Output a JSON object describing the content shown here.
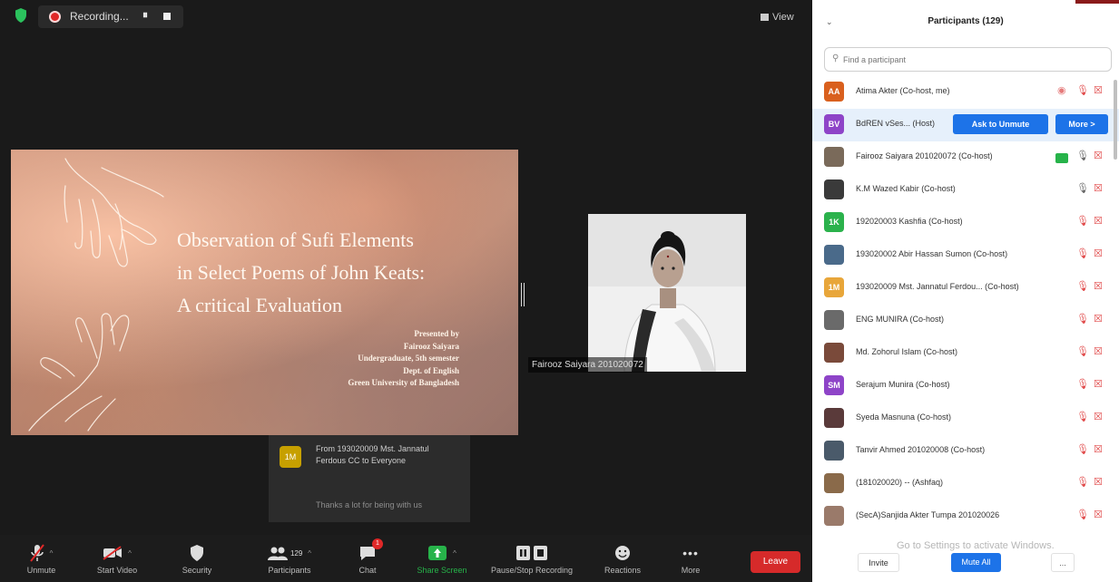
{
  "recording": {
    "label": "Recording...",
    "pause_glyph": "⏸",
    "state": "recording"
  },
  "view": {
    "label": "View"
  },
  "slide": {
    "title_lines": [
      "Observation of Sufi Elements",
      "in Select Poems of John Keats:",
      "A critical Evaluation"
    ],
    "presenter_lines": [
      "Presented by",
      "Fairooz Saiyara",
      "Undergraduate, 5th semester",
      "Dept. of English",
      "Green University of Bangladesh"
    ]
  },
  "video": {
    "name": "Fairooz Saiyara 201020072"
  },
  "chat": {
    "avatar_initials": "1M",
    "from_line": "From 193020009 Mst. Jannatul Ferdous CC to Everyone",
    "message": "Thanks a lot for being with us"
  },
  "toolbar": {
    "unmute": "Unmute",
    "start_video": "Start Video",
    "security": "Security",
    "participants": "Participants",
    "participants_count": "129",
    "chat": "Chat",
    "chat_badge": "1",
    "share_screen": "Share Screen",
    "pause_stop_recording": "Pause/Stop Recording",
    "reactions": "Reactions",
    "more": "More",
    "leave": "Leave",
    "colors": {
      "share": "#27b34a",
      "leave": "#d62a2a",
      "chat_badge": "#e02828"
    }
  },
  "panel": {
    "title": "Participants (129)",
    "search_placeholder": "Find a participant",
    "participants": [
      {
        "initials": "AA",
        "color": "#d9601e",
        "name": "Atima Akter (Co-host, me)",
        "recording": true,
        "mic": "off",
        "video": "off"
      },
      {
        "initials": "BV",
        "color": "#8e44c8",
        "name": "BdREN vSes... (Host)",
        "actions": [
          "Ask to Unmute",
          "More >"
        ]
      },
      {
        "initials": "",
        "color": "#7a6a5a",
        "name": "Fairooz Saiyara 201020072 (Co-host)",
        "mic": "on",
        "video": "on"
      },
      {
        "initials": "",
        "color": "#3a3a3a",
        "name": "K.M Wazed Kabir (Co-host)",
        "mic": "on",
        "video": "off"
      },
      {
        "initials": "1K",
        "color": "#2bb24c",
        "name": "192020003 Kashfia (Co-host)",
        "mic": "off",
        "video": "off"
      },
      {
        "initials": "",
        "color": "#4a6a8a",
        "name": "193020002 Abir Hassan Sumon (Co-host)",
        "mic": "off",
        "video": "off"
      },
      {
        "initials": "1M",
        "color": "#e8a63a",
        "name": "193020009 Mst. Jannatul Ferdou... (Co-host)",
        "mic": "off",
        "video": "off"
      },
      {
        "initials": "",
        "color": "#6a6a6a",
        "name": "ENG MUNIRA (Co-host)",
        "mic": "off",
        "video": "off"
      },
      {
        "initials": "",
        "color": "#7a4a3a",
        "name": "Md. Zohorul Islam (Co-host)",
        "mic": "off",
        "video": "off"
      },
      {
        "initials": "SM",
        "color": "#8e44c8",
        "name": "Serajum Munira (Co-host)",
        "mic": "off",
        "video": "off"
      },
      {
        "initials": "",
        "color": "#5a3a3a",
        "name": "Syeda Masnuna (Co-host)",
        "mic": "off",
        "video": "off"
      },
      {
        "initials": "",
        "color": "#4a5a6a",
        "name": "Tanvir Ahmed 201020008 (Co-host)",
        "mic": "off",
        "video": "off"
      },
      {
        "initials": "",
        "color": "#8a6a4a",
        "name": "(181020020) -- (Ashfaq)",
        "mic": "off",
        "video": "off"
      },
      {
        "initials": "",
        "color": "#9a7a6a",
        "name": "(SecA)Sanjida Akter Tumpa 201020026",
        "mic": "off",
        "video": "off"
      }
    ],
    "bottom": {
      "invite": "Invite",
      "mute_all": "Mute All",
      "more": "..."
    },
    "watermark": "Go to Settings to activate Windows."
  }
}
